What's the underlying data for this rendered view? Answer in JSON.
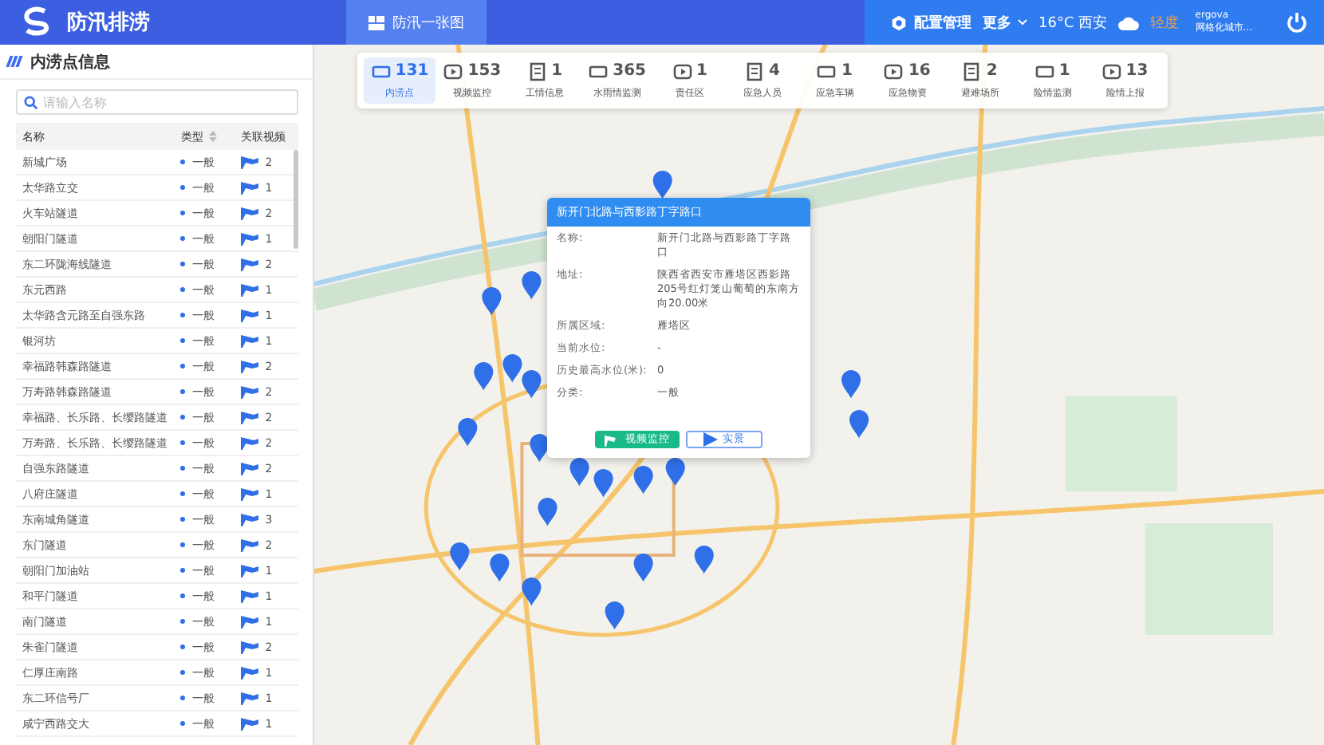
{
  "header": {
    "app_title": "防汛排涝",
    "nav": [
      {
        "label": "防汛一张图",
        "selected": true
      }
    ],
    "config": "配置管理",
    "more": "更多",
    "weather": "16°C 西安",
    "air_quality": "轻度",
    "user": {
      "name": "ergova",
      "org": "网格化城市..."
    }
  },
  "sidebar": {
    "title": "内涝点信息",
    "search": {
      "placeholder": "请输入名称"
    },
    "columns": [
      "名称",
      "类型",
      "关联视频"
    ],
    "rows": [
      {
        "name": "新城广场",
        "type": "一般",
        "videos": "2"
      },
      {
        "name": "太华路立交",
        "type": "一般",
        "videos": "1"
      },
      {
        "name": "火车站隧道",
        "type": "一般",
        "videos": "2"
      },
      {
        "name": "朝阳门隧道",
        "type": "一般",
        "videos": "1"
      },
      {
        "name": "东二环陇海线隧道",
        "type": "一般",
        "videos": "2"
      },
      {
        "name": "东元西路",
        "type": "一般",
        "videos": "1"
      },
      {
        "name": "太华路含元路至自强东路",
        "type": "一般",
        "videos": "1"
      },
      {
        "name": "银河坊",
        "type": "一般",
        "videos": "1"
      },
      {
        "name": "幸福路韩森路隧道",
        "type": "一般",
        "videos": "2"
      },
      {
        "name": "万寿路韩森路隧道",
        "type": "一般",
        "videos": "2"
      },
      {
        "name": "幸福路、长乐路、长缨路隧道",
        "type": "一般",
        "videos": "2"
      },
      {
        "name": "万寿路、长乐路、长缨路隧道",
        "type": "一般",
        "videos": "2"
      },
      {
        "name": "自强东路隧道",
        "type": "一般",
        "videos": "2"
      },
      {
        "name": "八府庄隧道",
        "type": "一般",
        "videos": "1"
      },
      {
        "name": "东南城角隧道",
        "type": "一般",
        "videos": "3"
      },
      {
        "name": "东门隧道",
        "type": "一般",
        "videos": "2"
      },
      {
        "name": "朝阳门加油站",
        "type": "一般",
        "videos": "1"
      },
      {
        "name": "和平门隧道",
        "type": "一般",
        "videos": "1"
      },
      {
        "name": "南门隧道",
        "type": "一般",
        "videos": "1"
      },
      {
        "name": "朱雀门隧道",
        "type": "一般",
        "videos": "2"
      },
      {
        "name": "仁厚庄南路",
        "type": "一般",
        "videos": "1"
      },
      {
        "name": "东二环信号厂",
        "type": "一般",
        "videos": "1"
      },
      {
        "name": "咸宁西路交大",
        "type": "一般",
        "videos": "1"
      }
    ]
  },
  "stats": [
    {
      "count": "131",
      "label": "内涝点",
      "selected": true
    },
    {
      "count": "153",
      "label": "视频监控",
      "selected": false
    },
    {
      "count": "1",
      "label": "工情信息",
      "selected": false
    },
    {
      "count": "365",
      "label": "水雨情监测",
      "selected": false
    },
    {
      "count": "1",
      "label": "责任区",
      "selected": false
    },
    {
      "count": "4",
      "label": "应急人员",
      "selected": false
    },
    {
      "count": "1",
      "label": "应急车辆",
      "selected": false
    },
    {
      "count": "16",
      "label": "应急物资",
      "selected": false
    },
    {
      "count": "2",
      "label": "避难场所",
      "selected": false
    },
    {
      "count": "1",
      "label": "险情监测",
      "selected": false
    },
    {
      "count": "13",
      "label": "险情上报",
      "selected": false
    }
  ],
  "popup": {
    "title": "新开门北路与西影路丁字路口",
    "fields": [
      {
        "label": "名称:",
        "value": "新开门北路与西影路丁字路口"
      },
      {
        "label": "地址:",
        "value": "陕西省西安市雁塔区西影路205号红灯笼山葡萄的东南方向20.00米"
      },
      {
        "label": "所属区域:",
        "value": "雁塔区"
      },
      {
        "label": "当前水位:",
        "value": "-"
      },
      {
        "label": "历史最高水位(米):",
        "value": "0"
      },
      {
        "label": "分类:",
        "value": "一般"
      }
    ],
    "buttons": [
      {
        "label": "视频监控",
        "kind": "primary"
      },
      {
        "label": "实景",
        "kind": "outline"
      }
    ]
  }
}
